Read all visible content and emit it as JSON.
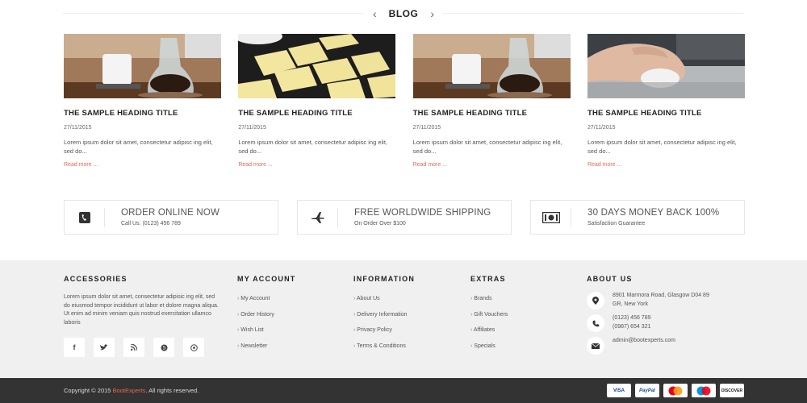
{
  "blog": {
    "title": "BLOG"
  },
  "posts": [
    {
      "heading": "THE SAMPLE HEADING TITLE",
      "date": "27/11/2015",
      "excerpt": "Lorem ipsum dolor sit amet, consectetur adipisc ing elit, sed do...",
      "more": "Read more ..."
    },
    {
      "heading": "THE SAMPLE HEADING TITLE",
      "date": "27/11/2015",
      "excerpt": "Lorem ipsum dolor sit amet, consectetur adipisc ing elit, sed do...",
      "more": "Read more ..."
    },
    {
      "heading": "THE SAMPLE HEADING TITLE",
      "date": "27/11/2015",
      "excerpt": "Lorem ipsum dolor sit amet, consectetur adipisc ing elit, sed do...",
      "more": "Read more ..."
    },
    {
      "heading": "THE SAMPLE HEADING TITLE",
      "date": "27/11/2015",
      "excerpt": "Lorem ipsum dolor sit amet, consectetur adipisc ing elit, sed do...",
      "more": "Read more ..."
    }
  ],
  "features": [
    {
      "title": "ORDER ONLINE NOW",
      "sub": "Call Us: (0123) 456 789",
      "icon": "phone-icon"
    },
    {
      "title": "FREE WORLDWIDE SHIPPING",
      "sub": "On Order Over $100",
      "icon": "airplane-icon"
    },
    {
      "title": "30 DAYS MONEY BACK 100%",
      "sub": "Satisfaction Guarantee",
      "icon": "money-icon"
    }
  ],
  "footer": {
    "accessories": {
      "title": "ACCESSORIES",
      "text": "Lorem ipsum dolor sit amet, consectetur adipisic ing elit, sed do eiusmod tempor incididunt ut labor et dolore magna aliqua. Ut enim ad minim veniam quis nostrud exercitation ullamco laboris",
      "socials": [
        "f",
        "t",
        "rss",
        "skype",
        "dribbble"
      ]
    },
    "account": {
      "title": "MY ACCOUNT",
      "items": [
        "My Account",
        "Order History",
        "Wish List",
        "Newsletter"
      ]
    },
    "information": {
      "title": "INFORMATION",
      "items": [
        "About Us",
        "Delivery Information",
        "Privacy Policy",
        "Terms & Conditions"
      ]
    },
    "extras": {
      "title": "EXTRAS",
      "items": [
        "Brands",
        "Gift Vouchers",
        "Affiliates",
        "Specials"
      ]
    },
    "about": {
      "title": "ABOUT US",
      "address1": "8901 Marmora Road, Glasgow D04 89",
      "address2": "GR, New York",
      "phone1": "(0123) 456 789",
      "phone2": "(0987) 654 321",
      "email": "admin@bootexperts.com"
    }
  },
  "bottom": {
    "copy_prefix": "Copyright © 2015 ",
    "brand": "BootExperts",
    "copy_suffix": ". All rights reserved.",
    "payments": [
      "VISA",
      "PayPal",
      "MC",
      "MC",
      "DISCOVER"
    ]
  }
}
